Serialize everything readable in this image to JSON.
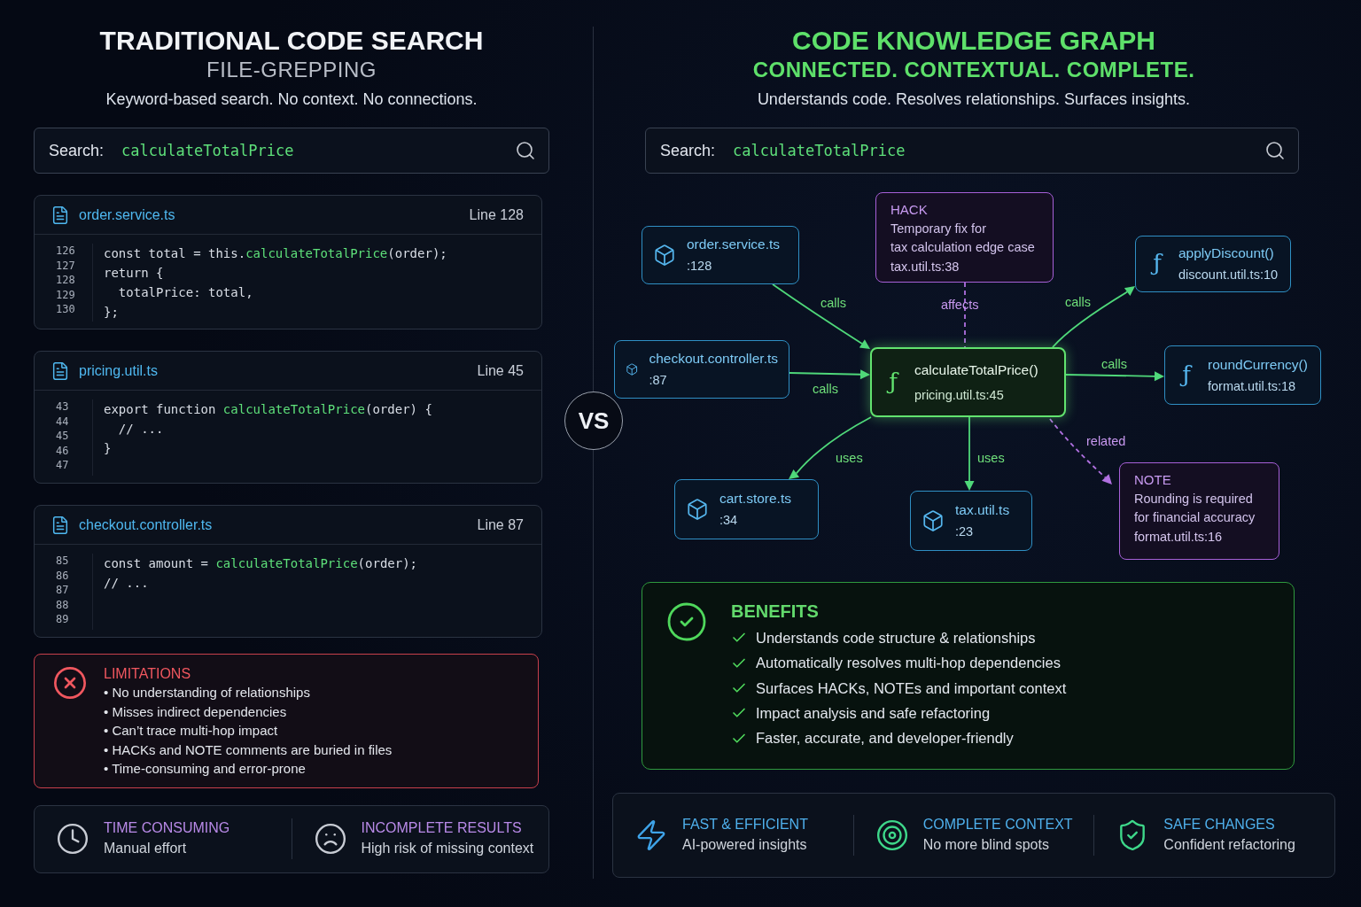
{
  "left": {
    "title": "TRADITIONAL CODE SEARCH",
    "subtitle": "FILE-GREPPING",
    "description": "Keyword-based search. No context. No connections.",
    "search": {
      "label": "Search:",
      "value": "calculateTotalPrice"
    },
    "results": [
      {
        "file": "order.service.ts",
        "line": "Line 128",
        "line_numbers": [
          "126",
          "127",
          "128",
          "129",
          "130"
        ],
        "code_lines": [
          [
            {
              "text": "const total = this.",
              "match": false
            },
            {
              "text": "calculateTotalPrice",
              "match": true
            },
            {
              "text": "(order);",
              "match": false
            }
          ],
          [
            {
              "text": "return {",
              "match": false
            }
          ],
          [
            {
              "text": "  totalPrice: total,",
              "match": false
            }
          ],
          [
            {
              "text": "};",
              "match": false
            }
          ]
        ]
      },
      {
        "file": "pricing.util.ts",
        "line": "Line 45",
        "line_numbers": [
          "43",
          "44",
          "45",
          "46",
          "47"
        ],
        "code_lines": [
          [
            {
              "text": "export function ",
              "match": false
            },
            {
              "text": "calculateTotalPrice",
              "match": true
            },
            {
              "text": "(order) {",
              "match": false
            }
          ],
          [
            {
              "text": "  // ...",
              "match": false
            }
          ],
          [
            {
              "text": "}",
              "match": false
            }
          ]
        ]
      },
      {
        "file": "checkout.controller.ts",
        "line": "Line 87",
        "line_numbers": [
          "85",
          "86",
          "87",
          "88",
          "89"
        ],
        "code_lines": [
          [
            {
              "text": "const amount = ",
              "match": false
            },
            {
              "text": "calculateTotalPrice",
              "match": true
            },
            {
              "text": "(order);",
              "match": false
            }
          ],
          [
            {
              "text": "// ...",
              "match": false
            }
          ]
        ]
      }
    ],
    "limitations": {
      "title": "LIMITATIONS",
      "items": [
        "• No understanding of relationships",
        "• Misses indirect dependencies",
        "• Can’t trace multi-hop impact",
        "• HACKs and NOTE comments are buried in files",
        "• Time-consuming and error-prone"
      ]
    },
    "stats": [
      {
        "kind": "clock",
        "title": "TIME CONSUMING",
        "text": "Manual effort"
      },
      {
        "kind": "sad-face",
        "title": "INCOMPLETE RESULTS",
        "text": "High risk of missing context"
      }
    ]
  },
  "vs_badge": "VS",
  "right": {
    "title": "CODE KNOWLEDGE GRAPH",
    "subtitle": "CONNECTED. CONTEXTUAL. COMPLETE.",
    "description": "Understands code. Resolves relationships. Surfaces insights.",
    "search": {
      "label": "Search:",
      "value": "calculateTotalPrice"
    },
    "graph": {
      "nodes": [
        {
          "kind": "file",
          "title": "order.service.ts",
          "location": ":128"
        },
        {
          "kind": "annotation",
          "title": "HACK",
          "body": [
            "Temporary fix for",
            "tax calculation edge case"
          ],
          "location": "tax.util.ts:38"
        },
        {
          "kind": "function",
          "icon_char": "ƒ",
          "title": "applyDiscount()",
          "location": "discount.util.ts:10"
        },
        {
          "kind": "file",
          "title": "checkout.controller.ts",
          "location": ":87"
        },
        {
          "kind": "focus",
          "icon_char": "ƒ",
          "title": "calculateTotalPrice()",
          "location": "pricing.util.ts:45"
        },
        {
          "kind": "function",
          "icon_char": "ƒ",
          "title": "roundCurrency()",
          "location": "format.util.ts:18"
        },
        {
          "kind": "file",
          "title": "cart.store.ts",
          "location": ":34"
        },
        {
          "kind": "file",
          "title": "tax.util.ts",
          "location": ":23"
        },
        {
          "kind": "annotation",
          "title": "NOTE",
          "body": [
            "Rounding is required",
            "for financial accuracy"
          ],
          "location": "format.util.ts:16"
        }
      ],
      "edges": [
        {
          "label": "calls",
          "kind": "solid",
          "arrow": true
        },
        {
          "label": "calls",
          "kind": "solid",
          "arrow": true
        },
        {
          "label": "affects",
          "kind": "dashed",
          "arrow": false
        },
        {
          "label": "calls",
          "kind": "solid",
          "arrow": true
        },
        {
          "label": "calls",
          "kind": "solid",
          "arrow": true
        },
        {
          "label": "uses",
          "kind": "solid",
          "arrow": true
        },
        {
          "label": "uses",
          "kind": "solid",
          "arrow": true
        },
        {
          "label": "related",
          "kind": "dashed",
          "arrow": true
        }
      ]
    },
    "benefits": {
      "title": "BENEFITS",
      "items": [
        "Understands code structure & relationships",
        "Automatically resolves multi-hop dependencies",
        "Surfaces HACKs, NOTEs and important context",
        "Impact analysis and safe refactoring",
        "Faster, accurate, and developer-friendly"
      ]
    },
    "features": [
      {
        "kind": "bolt",
        "title": "FAST & EFFICIENT",
        "text": "AI-powered insights"
      },
      {
        "kind": "target",
        "title": "COMPLETE CONTEXT",
        "text": "No more blind spots"
      },
      {
        "kind": "shield",
        "title": "SAFE CHANGES",
        "text": "Confident refactoring"
      }
    ]
  }
}
